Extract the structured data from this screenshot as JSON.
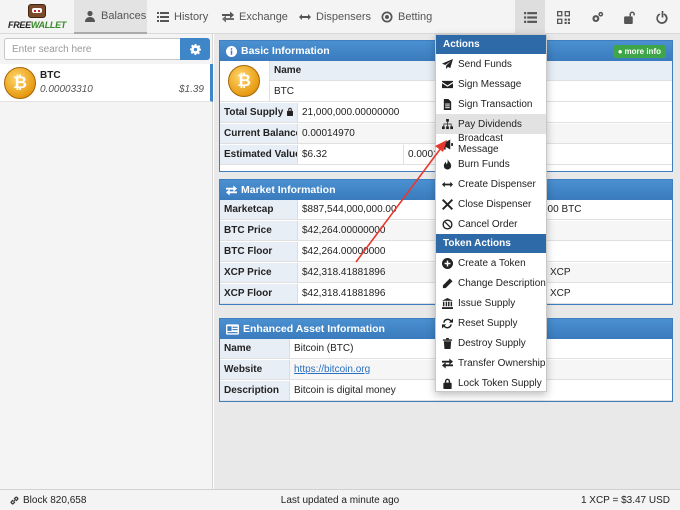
{
  "nav": {
    "logo": {
      "free": "FREE",
      "wallet": "WALLET"
    },
    "tabs": [
      {
        "label": "Balances",
        "icon": "user-icon",
        "active": true
      },
      {
        "label": "History",
        "icon": "list-icon"
      },
      {
        "label": "Exchange",
        "icon": "exchange-icon"
      },
      {
        "label": "Dispensers",
        "icon": "arrows-icon"
      },
      {
        "label": "Betting",
        "icon": "target-icon"
      }
    ],
    "tools": [
      "list-icon",
      "qrcode-icon",
      "cogs-icon",
      "unlock-icon",
      "power-icon"
    ]
  },
  "sidebar": {
    "search_placeholder": "Enter search here",
    "assets": [
      {
        "symbol": "BTC",
        "amount": "0.00003310",
        "usd": "$1.39",
        "icon": "bitcoin-coin-icon"
      }
    ]
  },
  "basic": {
    "title": "Basic Information",
    "more_label": "more info",
    "name_header": "Name",
    "name_value": "BTC",
    "rows": [
      {
        "label": "Total Supply",
        "value": "21,000,000.00000000",
        "extra": ""
      },
      {
        "label": "Current Balance",
        "value": "0.00014970",
        "extra": ""
      },
      {
        "label": "Estimated Value",
        "value": "$6.32",
        "extra": "0.0001"
      }
    ]
  },
  "market": {
    "title": "Market Information",
    "rows": [
      {
        "label": "Marketcap",
        "value": "$887,544,000,000.00",
        "extra": "000 BTC"
      },
      {
        "label": "BTC Price",
        "value": "$42,264.00000000",
        "extra": ""
      },
      {
        "label": "BTC Floor",
        "value": "$42,264.00000000",
        "extra": ""
      },
      {
        "label": "XCP Price",
        "value": "$42,318.41881896",
        "extra": "XCP"
      },
      {
        "label": "XCP Floor",
        "value": "$42,318.41881896",
        "extra": "XCP"
      }
    ]
  },
  "enhanced": {
    "title": "Enhanced Asset Information",
    "rows": [
      {
        "label": "Name",
        "value": "Bitcoin (BTC)"
      },
      {
        "label": "Website",
        "value": "https://bitcoin.org"
      },
      {
        "label": "Description",
        "value": "Bitcoin is digital money"
      }
    ]
  },
  "menu": {
    "actions_header": "Actions",
    "actions": [
      {
        "label": "Send Funds",
        "icon": "paper-plane-icon"
      },
      {
        "label": "Sign Message",
        "icon": "envelope-icon"
      },
      {
        "label": "Sign Transaction",
        "icon": "file-icon"
      },
      {
        "label": "Pay Dividends",
        "icon": "sitemap-icon",
        "hover": true
      },
      {
        "label": "Broadcast Message",
        "icon": "bullhorn-icon"
      },
      {
        "label": "Burn Funds",
        "icon": "fire-icon"
      },
      {
        "label": "Create Dispenser",
        "icon": "arrows-h-icon"
      },
      {
        "label": "Close Dispenser",
        "icon": "close-icon"
      },
      {
        "label": "Cancel Order",
        "icon": "ban-icon"
      }
    ],
    "token_header": "Token Actions",
    "token_actions": [
      {
        "label": "Create a Token",
        "icon": "plus-circle-icon"
      },
      {
        "label": "Change Description",
        "icon": "pencil-icon"
      },
      {
        "label": "Issue Supply",
        "icon": "bank-icon"
      },
      {
        "label": "Reset Supply",
        "icon": "refresh-icon"
      },
      {
        "label": "Destroy Supply",
        "icon": "trash-icon"
      },
      {
        "label": "Transfer Ownership",
        "icon": "exchange-icon"
      },
      {
        "label": "Lock Token Supply",
        "icon": "lock-icon"
      }
    ]
  },
  "footer": {
    "block": "Block 820,658",
    "updated": "Last updated a minute ago",
    "rate": "1 XCP = $3.47 USD"
  },
  "colors": {
    "accent": "#3f86c8",
    "menu_header": "#2f6aa8",
    "more_button": "#3ea648",
    "arrow": "#e8382e"
  }
}
